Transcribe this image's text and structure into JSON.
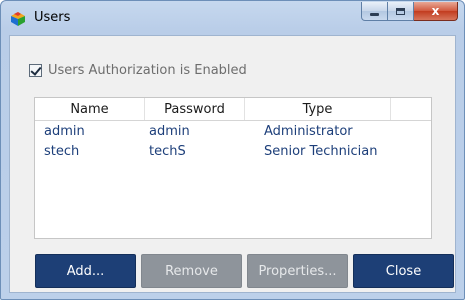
{
  "window": {
    "title": "Users",
    "caption_buttons": {
      "minimize": "minimize-icon",
      "maximize": "maximize-icon",
      "close": "x"
    }
  },
  "auth": {
    "checked": true,
    "label": "Users Authorization is Enabled"
  },
  "table": {
    "columns": [
      "Name",
      "Password",
      "Type"
    ],
    "rows": [
      {
        "name": "admin",
        "password": "admin",
        "type": "Administrator"
      },
      {
        "name": "stech",
        "password": "techS",
        "type": "Senior Technician"
      }
    ]
  },
  "buttons": {
    "add": "Add...",
    "remove": "Remove",
    "properties": "Properties...",
    "close": "Close"
  },
  "colors": {
    "primary_button": "#1d3f76",
    "disabled_button": "#8e949b",
    "row_text": "#1d3f7a"
  }
}
